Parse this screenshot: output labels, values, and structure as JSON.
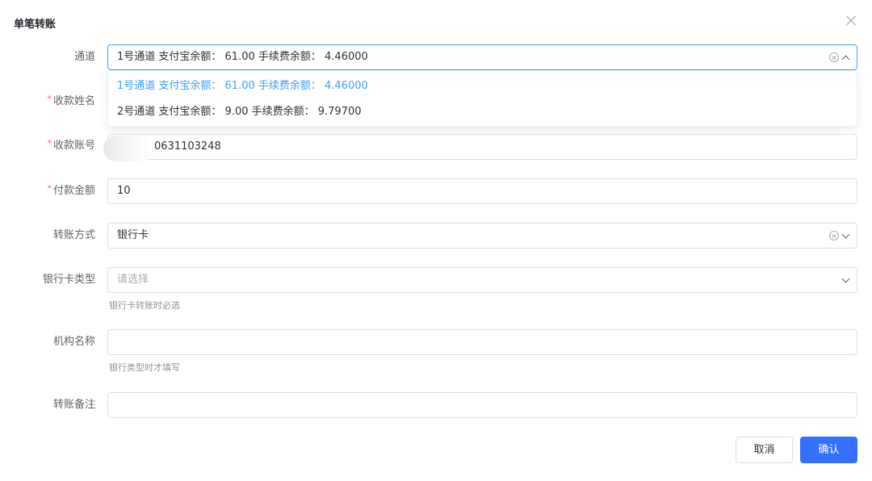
{
  "dialog": {
    "title": "单笔转账"
  },
  "form": {
    "channel": {
      "label": "通道",
      "value": "1号通道 支付宝余额： 61.00 手续费余额： 4.46000"
    },
    "channel_options": [
      {
        "label": "1号通道 支付宝余额： 61.00 手续费余额： 4.46000",
        "selected": true
      },
      {
        "label": "2号通道 支付宝余额： 9.00 手续费余额： 9.79700",
        "selected": false
      }
    ],
    "payee_name": {
      "label": "收款姓名",
      "required_mark": "*"
    },
    "payee_account": {
      "label": "收款账号",
      "required_mark": "*",
      "value": "0631103248"
    },
    "amount": {
      "label": "付款金额",
      "required_mark": "*",
      "value": "10"
    },
    "transfer_method": {
      "label": "转账方式",
      "value": "银行卡"
    },
    "card_type": {
      "label": "银行卡类型",
      "placeholder": "请选择",
      "hint": "银行卡转账时必选"
    },
    "institution": {
      "label": "机构名称",
      "hint": "银行类型时才填写"
    },
    "remark": {
      "label": "转账备注"
    }
  },
  "buttons": {
    "cancel": "取消",
    "confirm": "确认"
  },
  "colors": {
    "primary": "#3370ff",
    "selected_option": "#409eff",
    "required": "#f56c6c"
  }
}
